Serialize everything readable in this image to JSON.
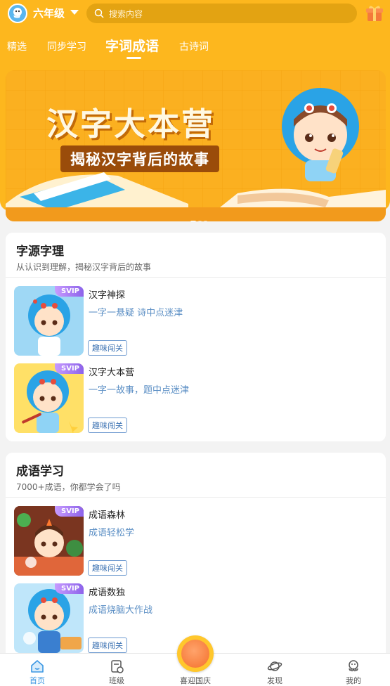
{
  "topbar": {
    "grade": "六年级",
    "search_placeholder": "搜索内容",
    "icons": [
      "avatar-octopus-icon",
      "search-icon",
      "gift-icon"
    ]
  },
  "tabs": [
    {
      "label": "精选",
      "active": false
    },
    {
      "label": "同步学习",
      "active": false
    },
    {
      "label": "字词成语",
      "active": true
    },
    {
      "label": "古诗词",
      "active": false
    }
  ],
  "banner": {
    "title": "汉字大本营",
    "subtitle": "揭秘汉字背后的故事",
    "slides": 3,
    "current_slide": 1
  },
  "sections": [
    {
      "title": "字源字理",
      "subtitle": "从认识到理解，揭秘汉字背后的故事",
      "items": [
        {
          "badge": "SVIP",
          "name": "汉字神探",
          "desc": "一字一悬疑 诗中点迷津",
          "tag": "趣味闯关"
        },
        {
          "badge": "SVIP",
          "name": "汉字大本营",
          "desc": "一字一故事，题中点迷津",
          "tag": "趣味闯关"
        }
      ]
    },
    {
      "title": "成语学习",
      "subtitle": "7000+成语，你都学会了吗",
      "items": [
        {
          "badge": "SVIP",
          "name": "成语森林",
          "desc": "成语轻松学",
          "tag": "趣味闯关"
        },
        {
          "badge": "SVIP",
          "name": "成语数独",
          "desc": "成语烧脑大作战",
          "tag": "趣味闯关"
        }
      ]
    }
  ],
  "bottom_nav": [
    {
      "label": "首页",
      "icon": "home-icon",
      "active": true
    },
    {
      "label": "班级",
      "icon": "class-icon",
      "active": false
    },
    {
      "label": "喜迎国庆",
      "icon": "celebration-icon",
      "active": false
    },
    {
      "label": "发现",
      "icon": "planet-icon",
      "active": false
    },
    {
      "label": "我的",
      "icon": "profile-icon",
      "active": false
    }
  ],
  "colors": {
    "brand_yellow": "#fdb71e",
    "link_blue": "#5a8ec4",
    "svip_purple": "#8d63ea",
    "nav_active": "#3b97e3"
  }
}
